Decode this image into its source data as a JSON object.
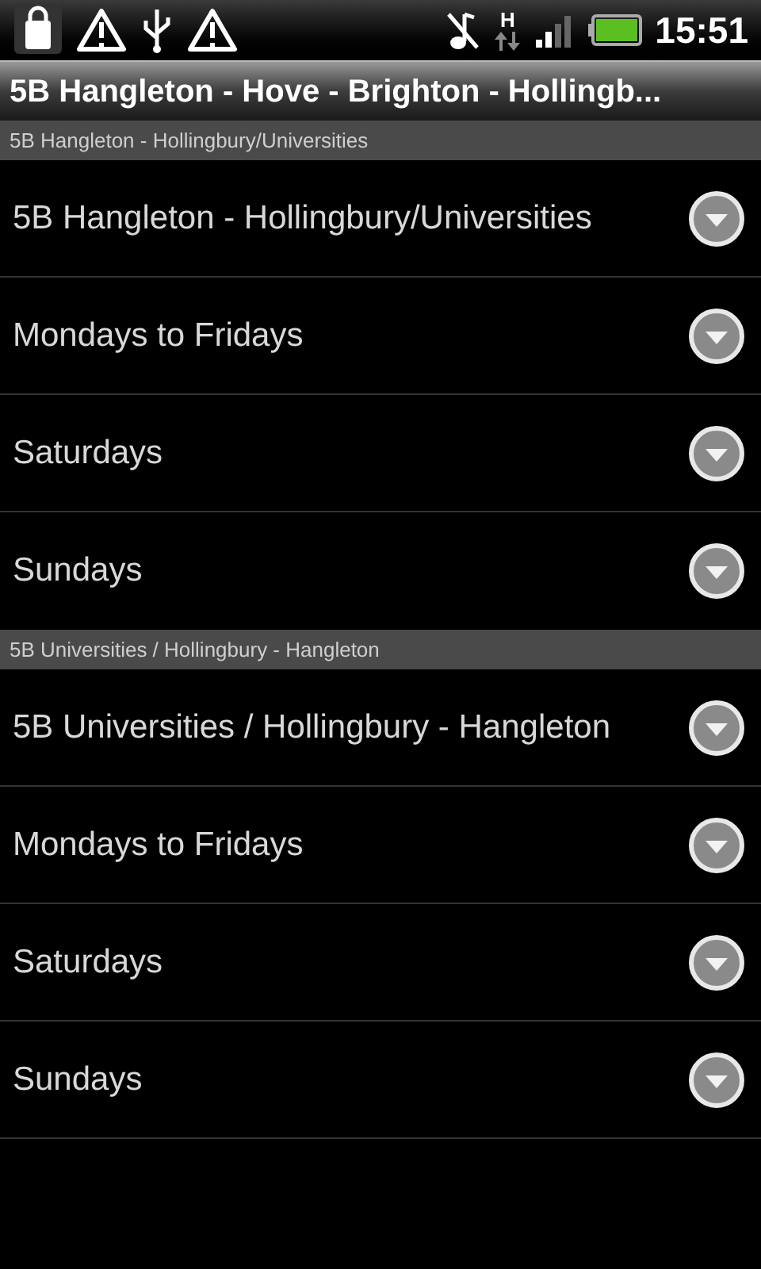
{
  "status_bar": {
    "time": "15:51",
    "network": "H"
  },
  "title": "5B Hangleton - Hove - Brighton - Hollingb...",
  "sections": [
    {
      "header": "5B Hangleton - Hollingbury/Universities",
      "items": [
        {
          "label": "5B Hangleton - Hollingbury/Universities"
        },
        {
          "label": "Mondays to Fridays"
        },
        {
          "label": "Saturdays"
        },
        {
          "label": "Sundays"
        }
      ]
    },
    {
      "header": "5B Universities / Hollingbury - Hangleton",
      "items": [
        {
          "label": "5B Universities / Hollingbury - Hangleton"
        },
        {
          "label": "Mondays to Fridays"
        },
        {
          "label": "Saturdays"
        },
        {
          "label": "Sundays"
        }
      ]
    }
  ]
}
